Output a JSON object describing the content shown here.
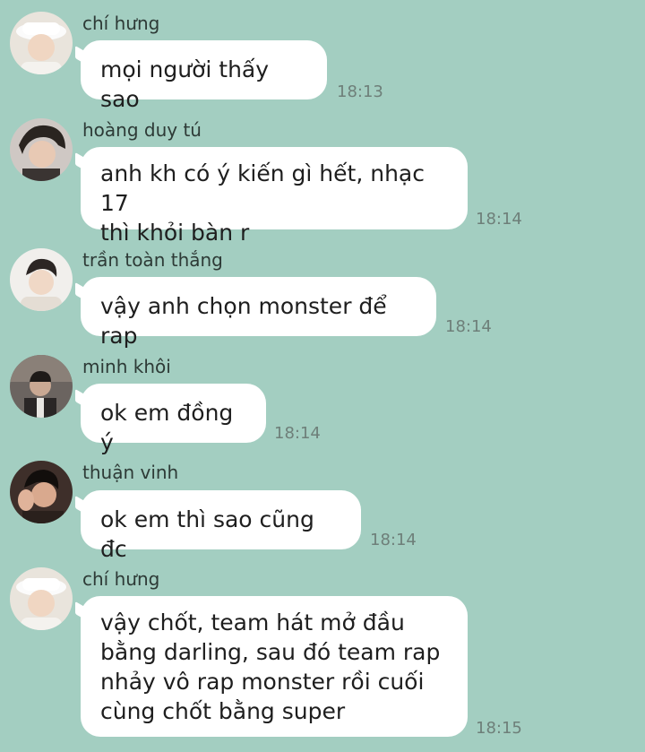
{
  "messages": [
    {
      "sender": "chí hưng",
      "text": "mọi người thấy sao",
      "time": "18:13",
      "avatar": "avatar-white-hat"
    },
    {
      "sender": "hoàng duy tú",
      "text": "anh kh có ý kiến gì hết, nhạc 17\nthì khỏi bàn r",
      "time": "18:14",
      "avatar": "avatar-dark-hair"
    },
    {
      "sender": "trần toàn thắng",
      "text": "vậy anh chọn monster để rap",
      "time": "18:14",
      "avatar": "avatar-light"
    },
    {
      "sender": "minh khôi",
      "text": "ok em đồng ý",
      "time": "18:14",
      "avatar": "avatar-dark-scene"
    },
    {
      "sender": "thuận vinh",
      "text": "ok em thì sao cũng đc",
      "time": "18:14",
      "avatar": "avatar-hand-wave"
    },
    {
      "sender": "chí hưng",
      "text": "vậy chốt, team hát mở đầu\nbằng darling, sau đó team rap\nnhảy vô rap monster rồi cuối\ncùng chốt bằng super",
      "time": "18:15",
      "avatar": "avatar-white-hat"
    }
  ],
  "colors": {
    "background": "#a3cec1",
    "bubble": "#ffffff",
    "time": "#6e7f79",
    "name": "#2d3a36"
  }
}
